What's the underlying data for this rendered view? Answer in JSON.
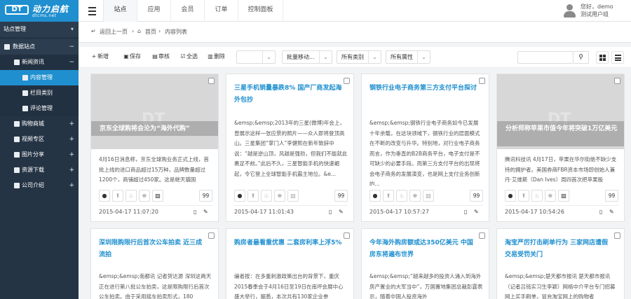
{
  "logo": {
    "mark": "DT",
    "name": "动力启航",
    "url": "dtcms.net"
  },
  "top_tabs": [
    "站点",
    "应用",
    "会员",
    "订单",
    "控制面板"
  ],
  "user": {
    "greeting": "您好，demo",
    "role": "测试用户组"
  },
  "sidebar": {
    "header": "站点管理",
    "items": [
      {
        "label": "数据站点",
        "sign": "−"
      },
      {
        "label": "新闻资讯",
        "sign": "−"
      },
      {
        "label": "内容管理",
        "sign": ""
      },
      {
        "label": "栏目类别",
        "sign": ""
      },
      {
        "label": "评论管理",
        "sign": ""
      },
      {
        "label": "购物商城",
        "sign": "+"
      },
      {
        "label": "视频专区",
        "sign": "+"
      },
      {
        "label": "图片分享",
        "sign": "+"
      },
      {
        "label": "资源下载",
        "sign": "+"
      },
      {
        "label": "公司介绍",
        "sign": "+"
      }
    ]
  },
  "breadcrumb": {
    "back": "返回上一页",
    "home": "首页",
    "current": "内容列表",
    "sep": "›"
  },
  "toolbar": {
    "add": "新增",
    "save": "保存",
    "audit": "审核",
    "select_all": "全选",
    "delete": "删除",
    "select_blank": "",
    "batch_move": "批量移动...",
    "all_categories": "所有类别",
    "all_attributes": "所有属性",
    "search_placeholder": ""
  },
  "cards": [
    {
      "title": "京东全球购将会沦为“海外代购”",
      "summary": "4月16日消息称，京东全球购业务正式上线，首批上线的进口商品超过15万种，品牌数量超过1200个，商铺超过450家。这是继天猫国",
      "count": "99",
      "date": "2015-04-17 11:07:20"
    },
    {
      "title": "三星手机销量暴跌8% 国产厂商发起海外包抄",
      "summary": "&emsp;&emsp;2013年的三星(微博)年会上，曾展示这样一张应景的照片——众人即将登顶高山。三星集团“掌门人”李健熙在新年致辞中说：“越是逆山顶，风越是强劲，但我们不能就此裹足不前。”此后不久，三星智能手机的快速崛起，令它登上全球智能手机霸主地位。&e...",
      "count": "99",
      "date": "2015-04-17 11:01:43"
    },
    {
      "title": "钢铁行业电子商务第三方支付平台探讨",
      "summary": "&emsp;&emsp;钢铁行业电子商务如今已发展十年余载，在这块领域下，钢铁行业的层面模式在不断的改变与升华。特别地，对行业电子商务而言，作为垂直的B2B商务平台，电子支付是不可缺少的必要手段。而第三方支付平台的出现将会电子商务的发展演变，也是网上支付业务创新的...",
      "count": "99",
      "date": "2015-04-17 10:57:27"
    },
    {
      "title": "分析师称苹果市值今年将突破1万亿美元",
      "summary": "腾讯科技讯 4月17日，苹果在华尔街绝不缺少支持的拥护者。美国券商FBR资本市场即创始人兼丹·艾维斯（Dan Ives）周四首次把苹果股",
      "count": "99",
      "date": "2015-04-17 10:54:26"
    },
    {
      "title": "深圳限购限行后首次公车拍卖 近三成流拍",
      "summary": "&emsp;&emsp;南都讯 记者贺达源 深圳这两天正在进行第八批公车拍卖，这是限购限行后首次公车拍卖。由于采用摇车拍卖形式，180"
    },
    {
      "title": "购房者最看重优惠 二套房利率上浮5%",
      "summary": "编者按：在多重刺激政策出台的背景下，重庆2015春季会于4月16日至19日在南坪会展中心盛大举行，据悉，本次共有130家企业参"
    },
    {
      "title": "今年海外购房额或达350亿美元 中国房东将遍布世界",
      "summary": "&emsp;&emsp;“越来越多的投资人涌入到海外房产置业的大军当中”，万国置地集团总裁彭霆表示，随着中国人投资海外"
    },
    {
      "title": "淘宝严厉打击刷单行为 三家网店遭假交易受罚关门",
      "summary": "&emsp;&emsp;楚天都市报讯 楚天都市报讯（记者吕铭实习生李颖）网络中介平台专门招募网上买手刷单，冒充淘宝网上的购物者"
    }
  ]
}
